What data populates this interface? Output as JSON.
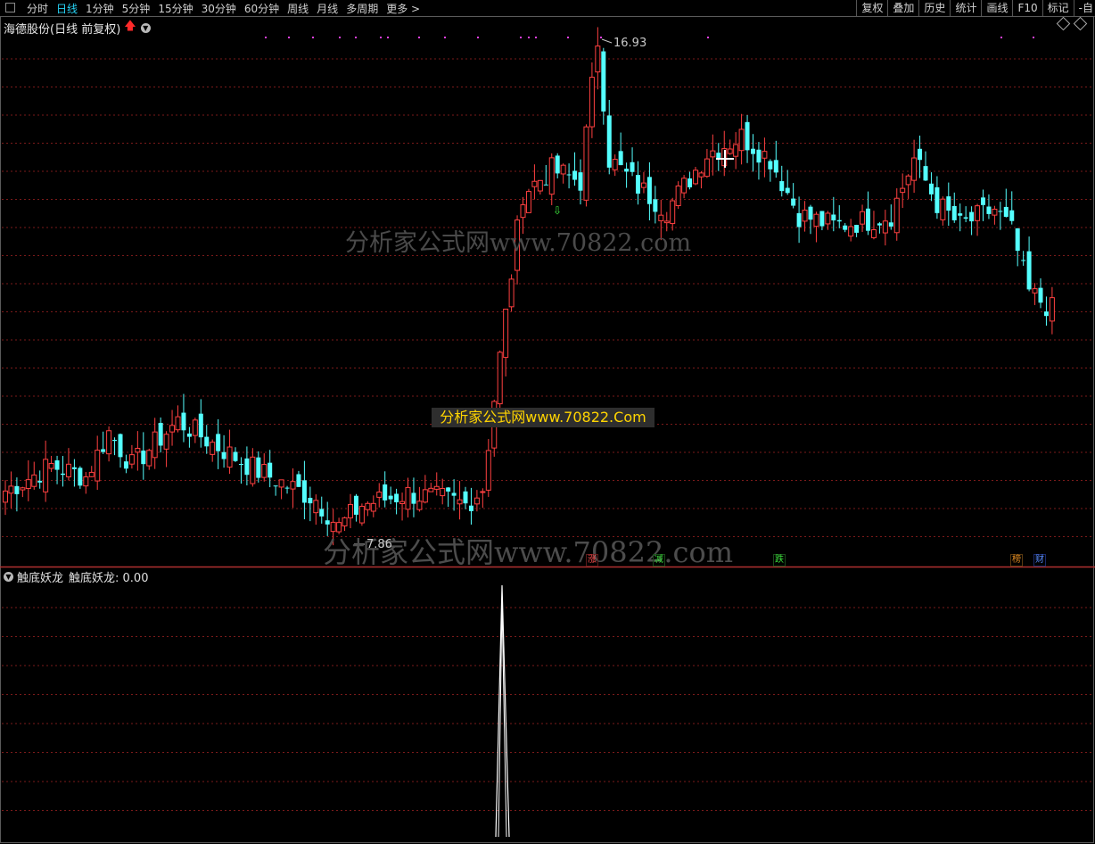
{
  "toolbar": {
    "tabs": [
      "分时",
      "日线",
      "1分钟",
      "5分钟",
      "15分钟",
      "30分钟",
      "60分钟",
      "周线",
      "月线",
      "多周期",
      "更多 >"
    ],
    "active_tab": "日线",
    "right_tools": [
      "复权",
      "叠加",
      "历史",
      "统计",
      "画线",
      "F10",
      "标记",
      "-自"
    ]
  },
  "main_chart": {
    "title": "海德股份(日线 前复权)",
    "high_label": "16.93",
    "low_label": "7.86",
    "watermark_center": "分析家公式网www.70822.com",
    "watermark_banner": "分析家公式网www.70822.Com",
    "watermark_bottom": "分析家公式网www.70822.com",
    "badges": [
      {
        "text": "涨",
        "color": "#ff5050"
      },
      {
        "text": "减",
        "color": "#3ce03c"
      },
      {
        "text": "跌",
        "color": "#3ce03c"
      },
      {
        "text": "榜",
        "color": "#e08a20"
      },
      {
        "text": "财",
        "color": "#5a8cff"
      }
    ],
    "colors": {
      "up": "#ff4040",
      "down": "#54ffff",
      "grid": "#7a1a1a",
      "text": "#c8c8c8"
    }
  },
  "indicator": {
    "name": "触底妖龙",
    "label": "触底妖龙: 0.00"
  },
  "chart_data": {
    "type": "candlestick",
    "high": 16.93,
    "low": 7.86,
    "indicator_series": {
      "name": "触底妖龙",
      "value_shown": 0.0
    }
  }
}
